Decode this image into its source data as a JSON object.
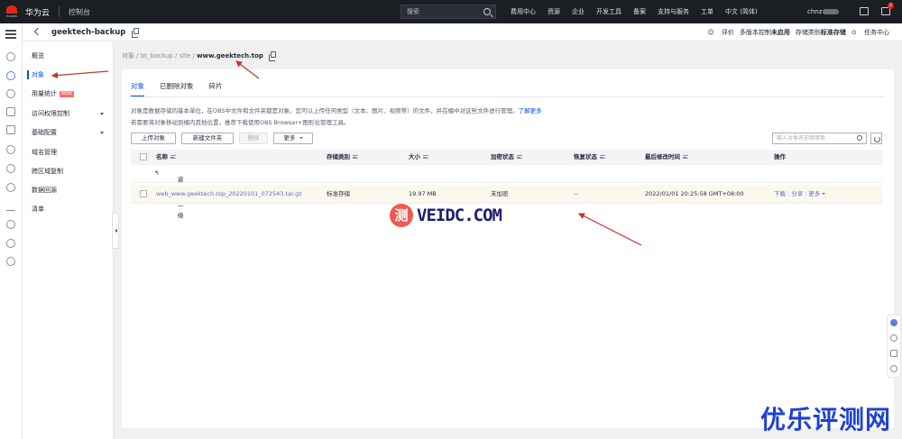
{
  "topbar": {
    "logo_text": "HUAWEI",
    "brand": "华为云",
    "console": "控制台",
    "search_placeholder": "搜索",
    "nav": [
      "费用中心",
      "资源",
      "企业",
      "开发工具",
      "备案",
      "支持与服务",
      "工单",
      "中文 (简体)"
    ],
    "user": "chnz",
    "badge_count": "2"
  },
  "subheader": {
    "bucket_name": "geektech-backup",
    "rating": "评价",
    "versioning_label": "多版本控制",
    "versioning_value": "未启用",
    "storage_class_label": "存储类别",
    "storage_class_value": "标准存储",
    "task_center": "任务中心"
  },
  "sidenav": {
    "items": [
      {
        "label": "概览",
        "active": false
      },
      {
        "label": "对象",
        "active": true
      },
      {
        "label": "用量统计",
        "active": false,
        "badge": "NEW"
      },
      {
        "label": "访问权限控制",
        "active": false,
        "expandable": true
      },
      {
        "label": "基础配置",
        "active": false,
        "expandable": true
      },
      {
        "label": "域名管理",
        "active": false
      },
      {
        "label": "跨区域复制",
        "active": false
      },
      {
        "label": "数据回源",
        "active": false
      },
      {
        "label": "清单",
        "active": false
      }
    ]
  },
  "breadcrumb": {
    "parts": [
      "对象",
      "bt_backup",
      "site"
    ],
    "current": "www.geektech.top"
  },
  "tabs": [
    {
      "label": "对象",
      "active": true
    },
    {
      "label": "已删除对象",
      "active": false
    },
    {
      "label": "碎片",
      "active": false
    }
  ],
  "description": {
    "line1": "对象是数据存储的基本单位，在OBS中文件和文件夹都是对象。您可以上传任何类型（文本、图片、视频等）的文件，并在桶中对这些文件进行管理。",
    "line1_link": "了解更多",
    "line2": "若需要将对象移动到桶内其他位置，推荐下载使用OBS Browser+图形化管理工具。"
  },
  "toolbar": {
    "upload": "上传对象",
    "new_folder": "新建文件夹",
    "delete": "删除",
    "more": "更多",
    "search_placeholder": "输入对象名前缀搜索"
  },
  "table": {
    "headers": [
      "名称",
      "存储类别",
      "大小",
      "加密状态",
      "恢复状态",
      "最后修改时间",
      "操作"
    ],
    "back_link": "返回上一级",
    "rows": [
      {
        "name": "web_www.geektech.top_20220101_072543.tar.gz",
        "storage_class": "标准存储",
        "size": "19.97 MB",
        "encryption": "未加密",
        "restore": "--",
        "modified": "2022/01/01 20:25:58 GMT+08:00",
        "ops": [
          "下载",
          "分享",
          "更多"
        ]
      }
    ]
  },
  "watermarks": {
    "center_circle": "测",
    "center_text": "VEIDC.COM",
    "corner": "优乐评测网"
  },
  "colors": {
    "topbar_bg": "#1b1e23",
    "accent": "#0052d9",
    "link": "#526ecc",
    "row_highlight": "#fcf8ef",
    "annotation": "#c0392b"
  }
}
